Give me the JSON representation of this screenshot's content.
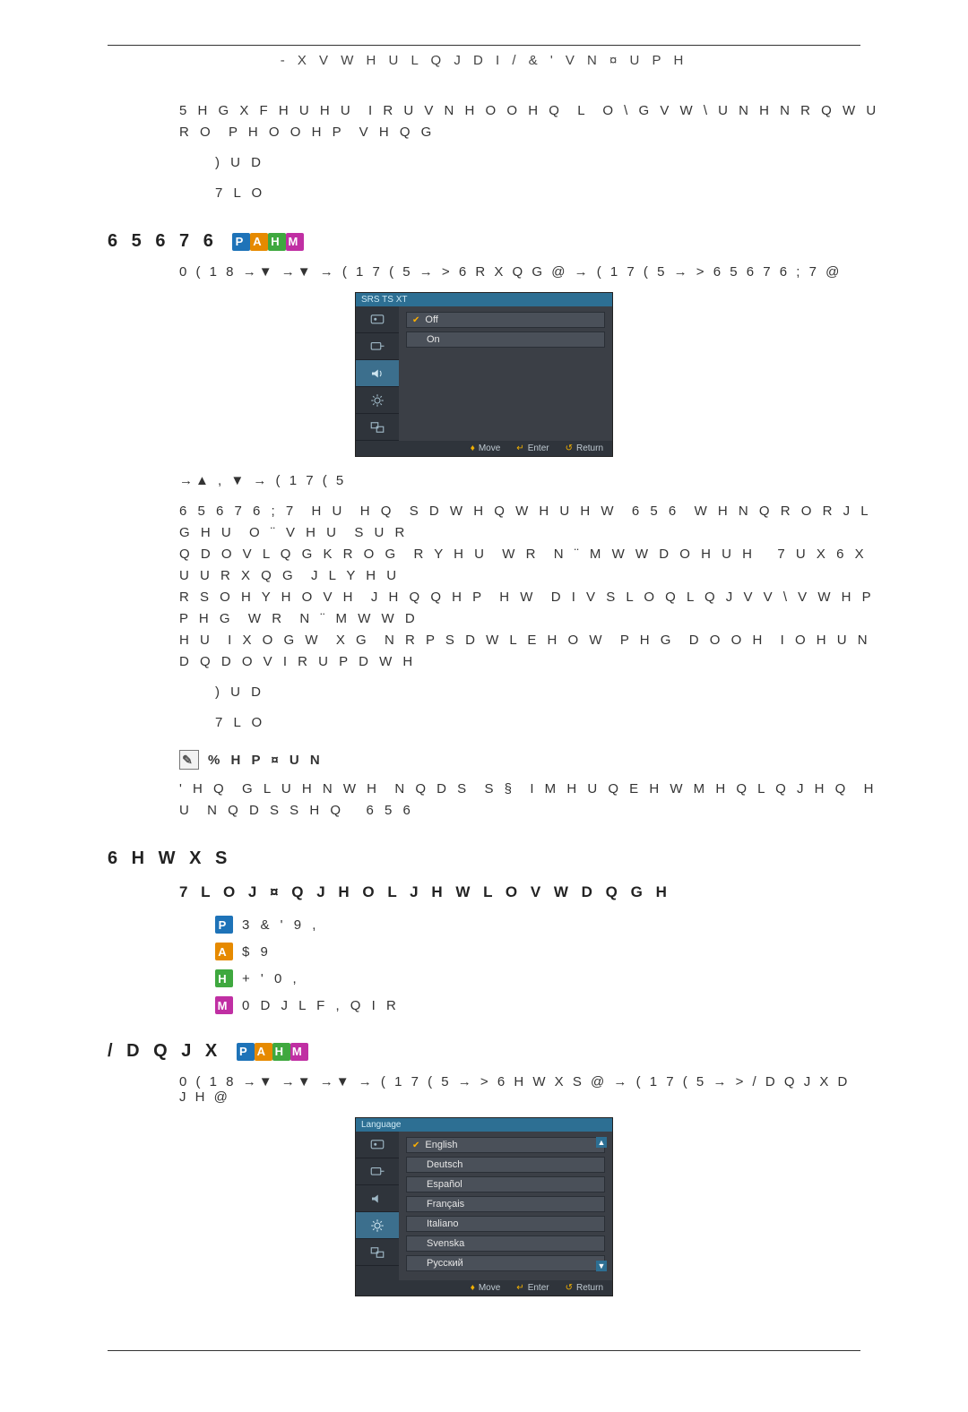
{
  "header": {
    "title": "- X V W H U L Q J  D I  / & '  V N ¤ U P H"
  },
  "intro": {
    "line1": "5 H G X F H U H U  I R U V N H O O H Q  L  O \\ G V W \\ U N H N R Q W U R O  P H O O H P  V H Q G",
    "fra": ") U D",
    "til": "7 L O"
  },
  "srs": {
    "heading": "6 5 6  7 6",
    "nav": "0 ( 1 8  →▼ →▼ →  ( 1 7 ( 5  →  > 6 R X Q G @  →  ( 1 7 ( 5  →  > 6 5 6  7 6  ; 7 @",
    "circled": "⊖, ⊕",
    "after_osd": "→▲ , ▼ →  ( 1 7 ( 5",
    "para1": "6 5 6 7 6 ; 7  H U  H Q  S D W H Q W H U H W  6 5 6  W H N Q R O R J L   G H U  O ¨ V H U  S U R",
    "para2": "Q D O V L Q G K R O G  R Y H U  W R  N ¨ M W W D O H U H   7 U X 6 X U U R X Q G  J L Y H U",
    "para3": "R S O H Y H O V H  J H Q Q H P  H W  D I V S L O Q L Q J V V \\ V W H P  P H G  W R  N ¨ M W W D",
    "para4": "H U  I X O G W  X G  N R P S D W L E H O W  P H G  D O O H  I O H U N D Q D O V I R U P D W H",
    "fra": ") U D",
    "til": "7 L O",
    "note_label": "% H P ¤ U N",
    "note_text": "' H Q  G L U H N W H  N Q D S  S §  I M H U Q E H W M H Q L Q J H Q  H U  N Q D S S H Q   6 5 6"
  },
  "setup": {
    "heading": "6 H W X S",
    "sub": "7 L O J ¤ Q J H O L J H  W L O V W D Q G H",
    "modes": [
      {
        "chip": "P",
        "label": "3 &    ' 9 ,"
      },
      {
        "chip": "A",
        "label": "$ 9"
      },
      {
        "chip": "H",
        "label": "+ ' 0 ,"
      },
      {
        "chip": "M",
        "label": "0 D J L F , Q I R"
      }
    ]
  },
  "language": {
    "heading": "/ D Q J X",
    "nav": "0 ( 1 8  →▼ →▼ →▼ →  ( 1 7 ( 5  →  > 6 H W X S @  →  ( 1 7 ( 5  →  > / D Q J X D J H  @"
  },
  "osd1": {
    "title": "SRS TS XT",
    "items": [
      {
        "label": "Off",
        "checked": true
      },
      {
        "label": "On",
        "checked": false
      }
    ],
    "footer": {
      "move": "Move",
      "enter": "Enter",
      "return": "Return"
    }
  },
  "osd2": {
    "title": "Language",
    "items": [
      {
        "label": "English",
        "checked": true
      },
      {
        "label": "Deutsch",
        "checked": false
      },
      {
        "label": "Español",
        "checked": false
      },
      {
        "label": "Français",
        "checked": false
      },
      {
        "label": "Italiano",
        "checked": false
      },
      {
        "label": "Svenska",
        "checked": false
      },
      {
        "label": "Русский",
        "checked": false
      }
    ],
    "footer": {
      "move": "Move",
      "enter": "Enter",
      "return": "Return"
    }
  },
  "icons": {
    "side": [
      "picture",
      "input",
      "sound",
      "setup",
      "multi"
    ]
  }
}
